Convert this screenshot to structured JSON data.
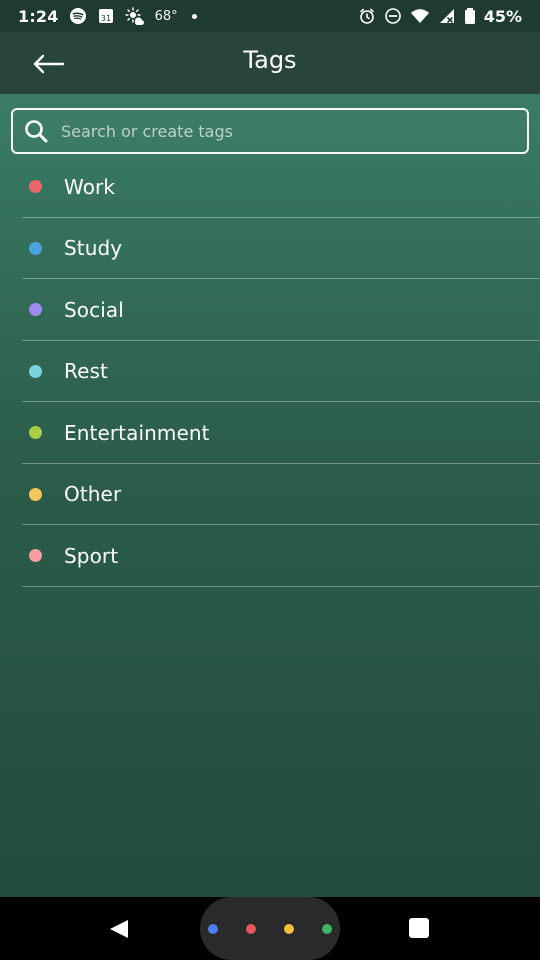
{
  "status_bar": {
    "time": "1:24",
    "temperature": "68°",
    "battery_percent": "45%",
    "icons_left": [
      "spotify-icon",
      "calendar-icon",
      "weather-icon",
      "notification-dot"
    ],
    "icons_right": [
      "alarm-icon",
      "do-not-disturb-icon",
      "wifi-icon",
      "cellular-icon",
      "battery-icon"
    ]
  },
  "header": {
    "title": "Tags",
    "back_icon": "back-arrow-icon"
  },
  "search": {
    "placeholder": "Search or create tags",
    "value": "",
    "icon": "search-icon"
  },
  "tags": [
    {
      "label": "Work",
      "color": "#e8676a"
    },
    {
      "label": "Study",
      "color": "#4aa3df"
    },
    {
      "label": "Social",
      "color": "#a08af0"
    },
    {
      "label": "Rest",
      "color": "#7ad3e0"
    },
    {
      "label": "Entertainment",
      "color": "#a8cc48"
    },
    {
      "label": "Other",
      "color": "#f4c55a"
    },
    {
      "label": "Sport",
      "color": "#f59da0"
    }
  ],
  "nav_bar": {
    "back_icon": "nav-back-icon",
    "home_icon": "google-home-icon",
    "recents_icon": "recents-icon",
    "home_dot_colors": [
      "#4f7ef0",
      "#e8575a",
      "#f2c23a",
      "#3fb56a"
    ]
  },
  "colors": {
    "status_bar_bg": "#1f3b31",
    "app_bar_bg": "#27453a",
    "content_gradient_top": "#3a7c67",
    "content_gradient_bottom": "#234b3d"
  }
}
